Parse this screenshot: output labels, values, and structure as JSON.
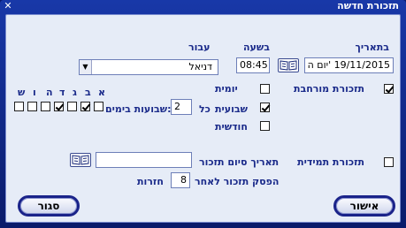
{
  "window": {
    "title": "תזכורת חדשה",
    "close_glyph": "✕"
  },
  "date": {
    "label": "בתאריך",
    "value": "19/11/2015 'יום ה"
  },
  "time": {
    "label": "בשעה",
    "value": "08:45"
  },
  "for": {
    "label": "עבור",
    "value": "דניאל",
    "arrow": "▼"
  },
  "extended": {
    "label": "תזכורת מורחבת",
    "checked": true
  },
  "daily": {
    "label": "יומית",
    "checked": false
  },
  "weekly": {
    "label": "שבועית",
    "checked": true
  },
  "monthly": {
    "label": "חודשית",
    "checked": false
  },
  "every": {
    "label": "כל",
    "value": "2",
    "suffix": "שבועות בימים:"
  },
  "weekdays": {
    "letters": [
      "א",
      "ב",
      "ג",
      "ד",
      "ה",
      "ו",
      "ש"
    ],
    "checked": [
      false,
      true,
      false,
      true,
      false,
      false,
      false
    ]
  },
  "permanent": {
    "label": "תזכורת תמידית",
    "checked": false
  },
  "end_date": {
    "label": "תאריך סיום תזכור",
    "value": ""
  },
  "stop": {
    "label": "הפסק תזכור לאחר",
    "value": "8",
    "suffix": "חזרות"
  },
  "buttons": {
    "ok": "אישור",
    "close": "סגור"
  }
}
